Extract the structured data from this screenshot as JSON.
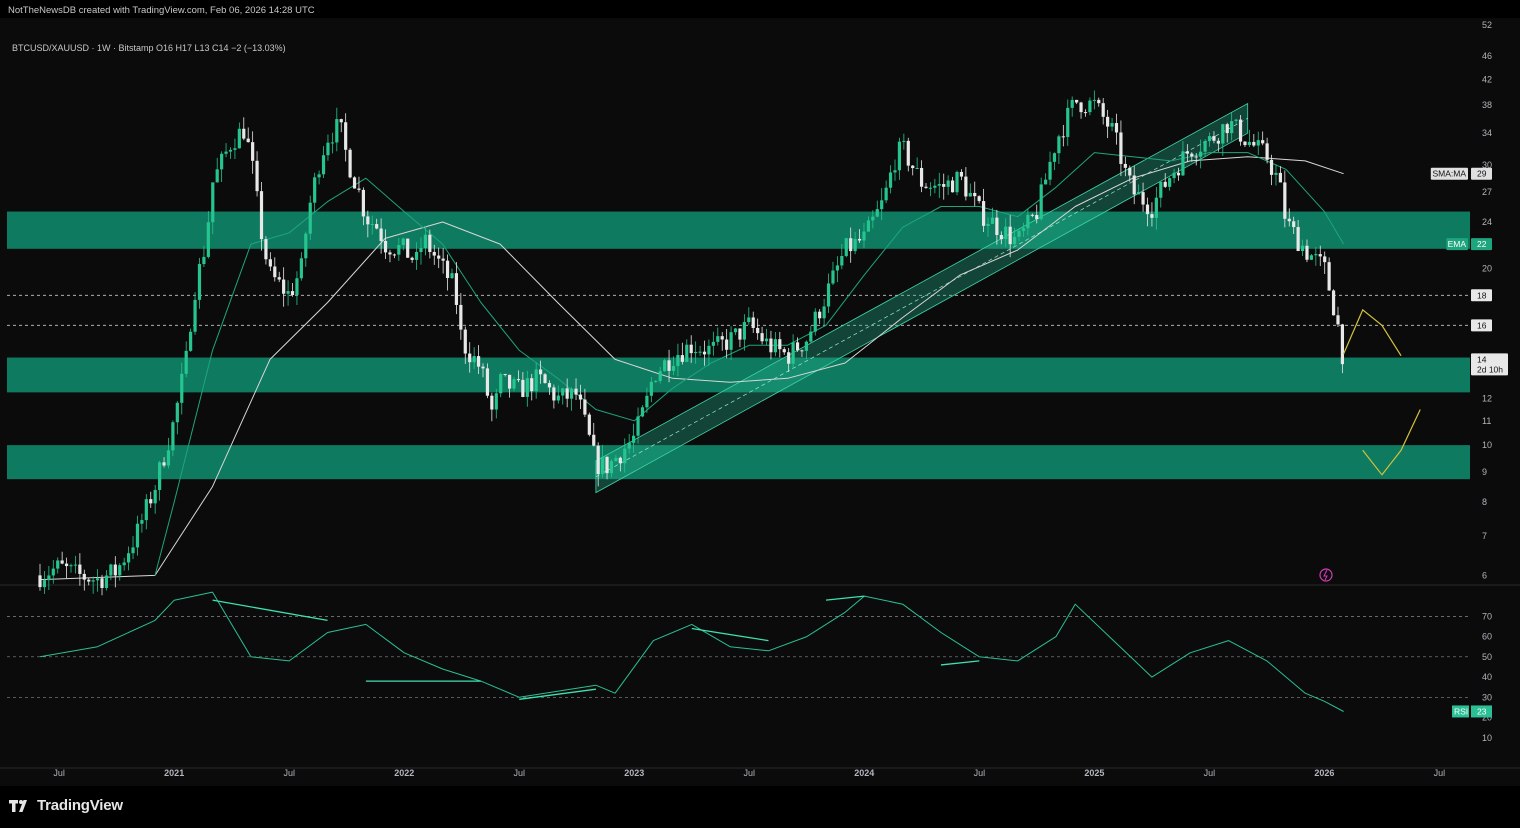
{
  "header": {
    "attribution": "NotTheNewsDB created with TradingView.com, Feb 06, 2026 14:28 UTC",
    "symbol_line": "BTCUSD/XAUUSD · 1W · Bitstamp  O16  H17  L13  C14  −2 (−13.03%)"
  },
  "footer": {
    "logo_text": "TradingView"
  },
  "colors": {
    "background": "#0b0b0b",
    "zone": "#0e7a5f",
    "up_candle": "#26c590",
    "down_candle": "#e8e8e8",
    "ema": "#1fa57e",
    "sma": "#d8d8d8",
    "rsi": "#2bbf95",
    "projection": "#d4c23c"
  },
  "chart_data": {
    "type": "candlestick",
    "scale": "log",
    "ylim": [
      5.8,
      53
    ],
    "x_ticks": [
      "Jul",
      "2021",
      "Jul",
      "2022",
      "Jul",
      "2023",
      "Jul",
      "2024",
      "Jul",
      "2025",
      "Jul",
      "2026",
      "Jul"
    ],
    "y_ticks": [
      52,
      46,
      42,
      38,
      34,
      30,
      27,
      24,
      20,
      18,
      16,
      14,
      12,
      11,
      10,
      9,
      8,
      7,
      6
    ],
    "support_resistance_zones": [
      {
        "low": 21.6,
        "high": 25.0
      },
      {
        "low": 12.3,
        "high": 14.1
      },
      {
        "low": 8.75,
        "high": 10.0
      }
    ],
    "horizontal_levels": [
      18,
      16
    ],
    "price_path_weekly_close": {
      "x": [
        "2020-06",
        "2020-07",
        "2020-08",
        "2020-09",
        "2020-10",
        "2020-11",
        "2020-12",
        "2021-01",
        "2021-01-20",
        "2021-02",
        "2021-02-20",
        "2021-03",
        "2021-04",
        "2021-04-20",
        "2021-05",
        "2021-05-20",
        "2021-06",
        "2021-07",
        "2021-07-20",
        "2021-08",
        "2021-08-20",
        "2021-09",
        "2021-09-20",
        "2021-10",
        "2021-10-20",
        "2021-11",
        "2021-11-20",
        "2021-12",
        "2022-01",
        "2022-01-20",
        "2022-02",
        "2022-03",
        "2022-03-20",
        "2022-04",
        "2022-05",
        "2022-05-20",
        "2022-06",
        "2022-07",
        "2022-08",
        "2022-09",
        "2022-10",
        "2022-11",
        "2022-11-20",
        "2022-12",
        "2023-01",
        "2023-01-20",
        "2023-02",
        "2023-03",
        "2023-04",
        "2023-05",
        "2023-06",
        "2023-07",
        "2023-08",
        "2023-09",
        "2023-10",
        "2023-11",
        "2023-12",
        "2024-01",
        "2024-02",
        "2024-02-20",
        "2024-03",
        "2024-04",
        "2024-05",
        "2024-06",
        "2024-07",
        "2024-08",
        "2024-09",
        "2024-10",
        "2024-11",
        "2024-12",
        "2025-01",
        "2025-02",
        "2025-02-20",
        "2025-03",
        "2025-04",
        "2025-05",
        "2025-06",
        "2025-07",
        "2025-08",
        "2025-09",
        "2025-10",
        "2025-10-20",
        "2025-11",
        "2025-12",
        "2026-01",
        "2026-01-20",
        "2026-02"
      ],
      "close": [
        6.0,
        6.2,
        6.0,
        5.9,
        6.1,
        7.0,
        8.5,
        11.0,
        14.0,
        18.0,
        22.0,
        28.0,
        33.0,
        34.5,
        31.0,
        22.0,
        19.5,
        18.0,
        20.0,
        25.0,
        31.0,
        33.5,
        35.0,
        31.0,
        27.0,
        24.5,
        23.5,
        22.0,
        21.5,
        20.5,
        22.5,
        20.0,
        18.5,
        15.0,
        13.5,
        11.2,
        12.8,
        12.4,
        13.0,
        12.0,
        12.2,
        9.3,
        9.2,
        9.5,
        10.3,
        11.8,
        13.2,
        14.2,
        14.8,
        14.5,
        15.1,
        16.0,
        14.8,
        14.2,
        15.2,
        18.0,
        21.5,
        22.5,
        26.0,
        31.0,
        32.0,
        28.0,
        27.5,
        28.5,
        25.0,
        23.5,
        22.2,
        25.0,
        33.0,
        38.5,
        38.0,
        34.0,
        29.0,
        27.0,
        25.5,
        29.0,
        32.0,
        33.0,
        35.5,
        33.0,
        31.0,
        28.0,
        24.0,
        21.5,
        20.0,
        16.5,
        14.0
      ]
    },
    "sma_path": {
      "x": [
        "2020-06",
        "2020-12",
        "2021-03",
        "2021-06",
        "2021-09",
        "2021-12",
        "2022-03",
        "2022-06",
        "2022-09",
        "2022-12",
        "2023-03",
        "2023-06",
        "2023-09",
        "2023-12",
        "2024-03",
        "2024-06",
        "2024-09",
        "2024-12",
        "2025-03",
        "2025-06",
        "2025-09",
        "2025-12",
        "2026-02"
      ],
      "value": [
        5.9,
        6.0,
        8.5,
        14.0,
        17.5,
        22.5,
        24.0,
        22.0,
        17.5,
        14.0,
        13.0,
        12.8,
        13.0,
        13.8,
        16.5,
        19.5,
        21.5,
        25.5,
        28.5,
        30.5,
        31.0,
        30.5,
        29.0
      ]
    },
    "ema_path": {
      "x": [
        "2020-12",
        "2021-01",
        "2021-03",
        "2021-05",
        "2021-07",
        "2021-09",
        "2021-11",
        "2022-01",
        "2022-03",
        "2022-05",
        "2022-07",
        "2022-09",
        "2022-11",
        "2023-01",
        "2023-03",
        "2023-05",
        "2023-07",
        "2023-09",
        "2023-11",
        "2024-01",
        "2024-03",
        "2024-05",
        "2024-07",
        "2024-09",
        "2024-11",
        "2025-01",
        "2025-03",
        "2025-05",
        "2025-07",
        "2025-09",
        "2025-11",
        "2026-01",
        "2026-02"
      ],
      "value": [
        6.0,
        8.0,
        14.5,
        22.0,
        23.0,
        26.0,
        28.5,
        25.0,
        22.0,
        17.5,
        14.5,
        13.0,
        11.5,
        11.0,
        12.5,
        13.8,
        14.8,
        14.8,
        16.0,
        19.5,
        23.5,
        25.5,
        25.5,
        24.5,
        27.5,
        31.5,
        31.0,
        30.5,
        31.5,
        31.5,
        29.5,
        25.0,
        22.0
      ]
    },
    "rising_channel": {
      "lower_start": {
        "x": "2022-11",
        "y": 8.3
      },
      "lower_end": {
        "x": "2025-09",
        "y": 34.0
      },
      "upper_start": {
        "x": "2022-11",
        "y": 9.4
      },
      "upper_end": {
        "x": "2025-09",
        "y": 38.2
      }
    },
    "projection_paths": [
      {
        "x": [
          "2026-02",
          "2026-03",
          "2026-04",
          "2026-05"
        ],
        "y": [
          14.3,
          17.0,
          16.0,
          14.2
        ]
      },
      {
        "x": [
          "2026-03",
          "2026-04",
          "2026-05",
          "2026-06"
        ],
        "y": [
          9.8,
          8.9,
          9.8,
          11.5
        ]
      }
    ],
    "price_labels": [
      {
        "text": "SMA:MA",
        "value": "29"
      },
      {
        "text": "EMA",
        "value": "22"
      },
      {
        "text": "",
        "value": "18"
      },
      {
        "text": "",
        "value": "16"
      },
      {
        "text": "",
        "value": "14",
        "countdown": "2d 10h"
      }
    ],
    "rsi": {
      "ylim": [
        0,
        85
      ],
      "y_ticks": [
        70,
        60,
        50,
        40,
        30,
        20,
        10
      ],
      "levels": [
        70,
        50,
        30
      ],
      "label": "RSI",
      "last_value": "23",
      "path": {
        "x": [
          "2020-06",
          "2020-09",
          "2020-12",
          "2021-01",
          "2021-03",
          "2021-05",
          "2021-07",
          "2021-09",
          "2021-11",
          "2022-01",
          "2022-03",
          "2022-05",
          "2022-07",
          "2022-09",
          "2022-11",
          "2022-12",
          "2023-02",
          "2023-04",
          "2023-06",
          "2023-08",
          "2023-10",
          "2023-12",
          "2024-01",
          "2024-03",
          "2024-05",
          "2024-07",
          "2024-09",
          "2024-11",
          "2024-12",
          "2025-02",
          "2025-04",
          "2025-06",
          "2025-08",
          "2025-10",
          "2025-12",
          "2026-01",
          "2026-02"
        ],
        "value": [
          50,
          55,
          68,
          78,
          82,
          50,
          48,
          62,
          66,
          52,
          44,
          38,
          30,
          33,
          36,
          32,
          58,
          66,
          55,
          53,
          60,
          72,
          80,
          76,
          62,
          50,
          48,
          60,
          76,
          58,
          40,
          52,
          58,
          48,
          32,
          28,
          23
        ]
      },
      "divergence_lines": [
        {
          "x": [
            "2021-03",
            "2021-09"
          ],
          "y": [
            78,
            68
          ]
        },
        {
          "x": [
            "2021-11",
            "2022-05"
          ],
          "y": [
            38,
            38
          ]
        },
        {
          "x": [
            "2022-07",
            "2022-11"
          ],
          "y": [
            29,
            34
          ]
        },
        {
          "x": [
            "2023-04",
            "2023-08"
          ],
          "y": [
            64,
            58
          ]
        },
        {
          "x": [
            "2023-11",
            "2024-01"
          ],
          "y": [
            78,
            80
          ]
        },
        {
          "x": [
            "2024-05",
            "2024-07"
          ],
          "y": [
            46,
            48
          ]
        }
      ]
    }
  }
}
